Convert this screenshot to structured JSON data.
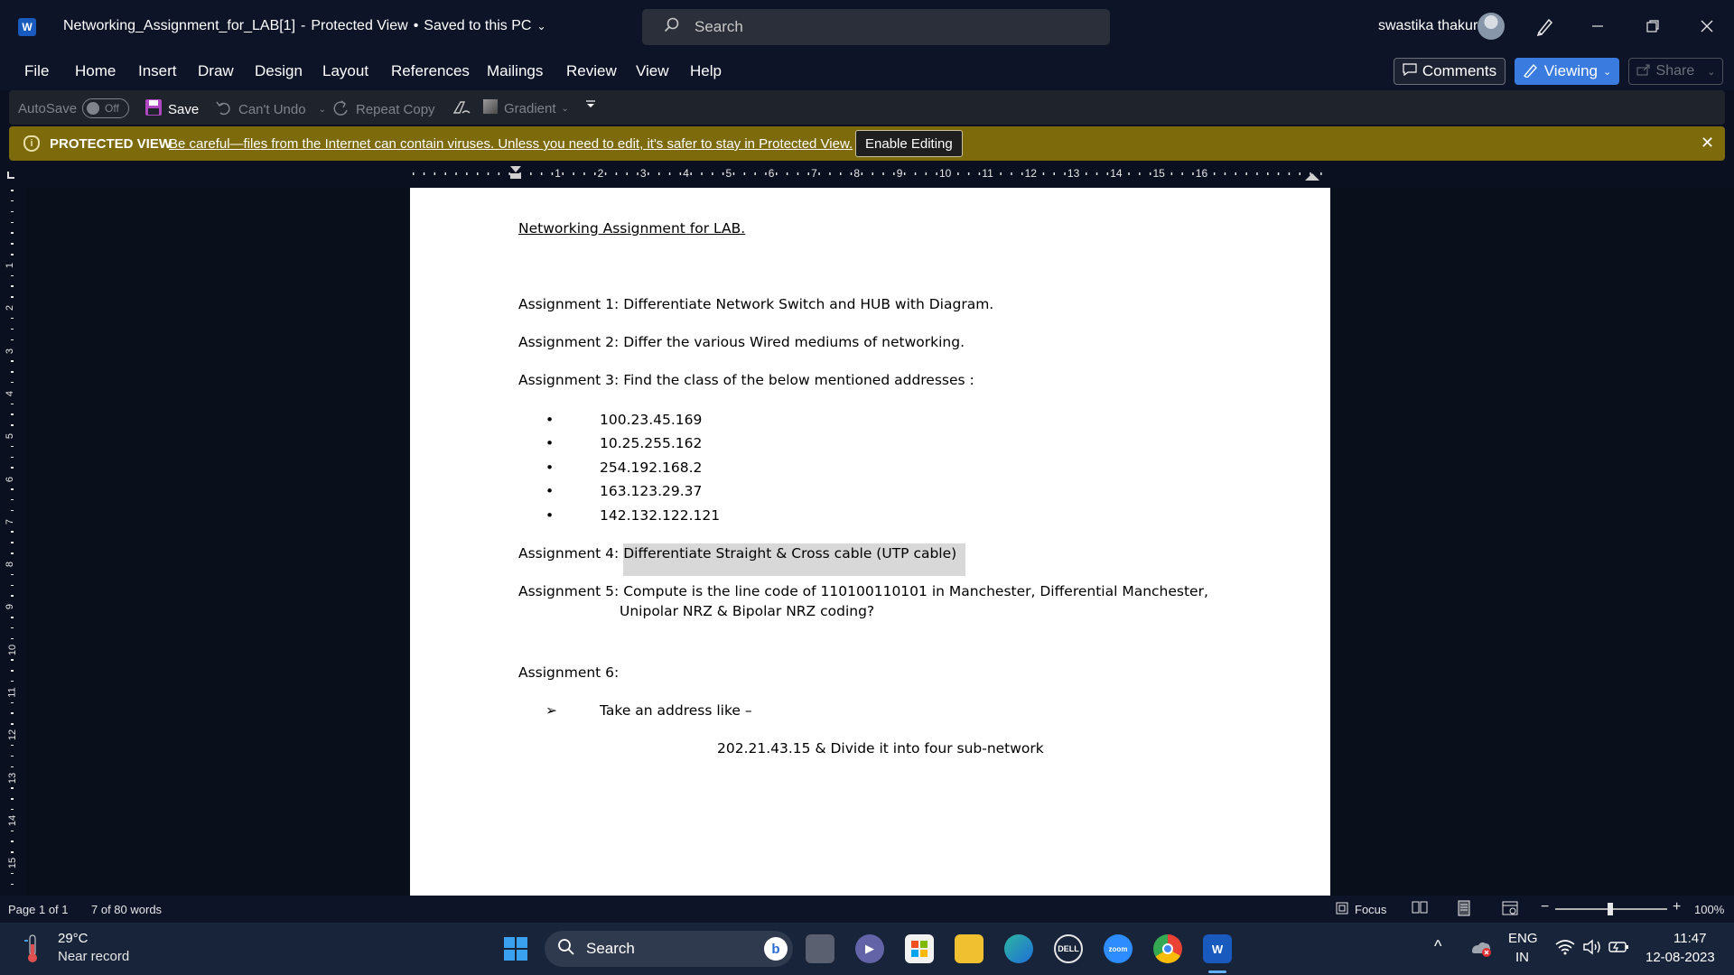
{
  "window": {
    "title": "Networking_Assignment_for_LAB[1]",
    "separator": "-",
    "status": "Protected View",
    "bullet": "•",
    "save_state": "Saved to this PC",
    "search_placeholder": "Search",
    "user_name": "swastika thakur"
  },
  "menu": {
    "items": [
      "File",
      "Home",
      "Insert",
      "Draw",
      "Design",
      "Layout",
      "References",
      "Mailings",
      "Review",
      "View",
      "Help"
    ],
    "comments": "Comments",
    "viewing": "Viewing",
    "share": "Share"
  },
  "toolbar": {
    "autosave": "AutoSave",
    "autosave_state": "Off",
    "save": "Save",
    "undo": "Can't Undo",
    "repeat": "Repeat Copy",
    "gradient": "Gradient"
  },
  "protected_view": {
    "title": "PROTECTED VIEW",
    "message": "Be careful—files from the Internet can contain viruses. Unless you need to edit, it's safer to stay in Protected View.",
    "button": "Enable Editing"
  },
  "ruler": {
    "h_numbers": [
      "1",
      "2",
      "3",
      "4",
      "5",
      "6",
      "7",
      "8",
      "9",
      "10",
      "11",
      "12",
      "13",
      "14",
      "15",
      "16"
    ],
    "v_numbers": [
      "1",
      "2",
      "3",
      "4",
      "5",
      "6",
      "7",
      "8",
      "9",
      "10",
      "11",
      "12",
      "13",
      "14",
      "15"
    ]
  },
  "document": {
    "heading": "Networking Assignment for LAB.",
    "a1": "Assignment 1: Differentiate Network Switch and HUB with Diagram.",
    "a2": "Assignment 2: Differ the various Wired mediums of networking.",
    "a3": "Assignment 3: Find the class of the below mentioned addresses :",
    "addresses": [
      "100.23.45.169",
      "10.25.255.162",
      "254.192.168.2",
      "163.123.29.37",
      "142.132.122.121"
    ],
    "bullet_symbol": "•",
    "a4_label": "Assignment 4:",
    "a4_text": "Differentiate Straight & Cross cable (UTP cable)",
    "a5_line1": "Assignment 5: Compute is the line code of 110100110101 in Manchester, Differential Manchester,",
    "a5_line2": "Unipolar NRZ & Bipolar NRZ coding?",
    "a6": "Assignment 6:",
    "arrow_symbol": "➢",
    "a6_bullet": "Take an address like –",
    "a6_center": "202.21.43.15 & Divide it into four sub-network"
  },
  "status_bar": {
    "page": "Page 1 of 1",
    "words": "7 of 80 words",
    "focus": "Focus",
    "zoom": "100%"
  },
  "taskbar": {
    "temp": "29°C",
    "weather": "Near record",
    "search": "Search",
    "lang1": "ENG",
    "lang2": "IN",
    "time": "11:47",
    "date": "12-08-2023"
  },
  "colors": {
    "accent": "#3a7be0",
    "protected_bar": "#7d6a0b",
    "word_blue": "#185abd"
  }
}
